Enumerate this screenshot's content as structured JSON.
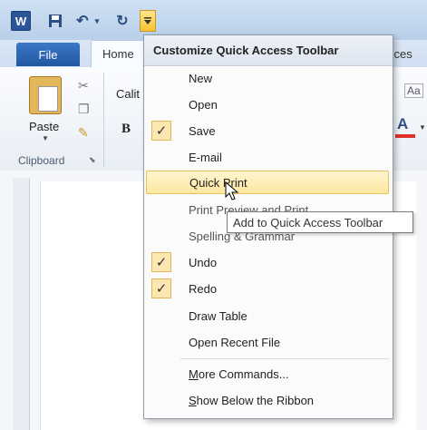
{
  "app": {
    "logo_letter": "W",
    "tabs": {
      "file": "File",
      "home": "Home",
      "references_partial": "ences"
    },
    "ribbon": {
      "paste": "Paste",
      "clipboard_group": "Clipboard",
      "font_name": "Calit",
      "bold": "B",
      "font_color": "A"
    }
  },
  "menu": {
    "title": "Customize Quick Access Toolbar",
    "items": [
      {
        "label": "New",
        "checked": false
      },
      {
        "label": "Open",
        "checked": false
      },
      {
        "label": "Save",
        "checked": true
      },
      {
        "label": "E-mail",
        "checked": false
      },
      {
        "label": "Quick Print",
        "checked": false,
        "hovered": true
      },
      {
        "label": "Print Preview and Print",
        "checked": false
      },
      {
        "label": "Spelling & Grammar",
        "checked": false
      },
      {
        "label": "Undo",
        "checked": true
      },
      {
        "label": "Redo",
        "checked": true
      },
      {
        "label": "Draw Table",
        "checked": false
      },
      {
        "label": "Open Recent File",
        "checked": false
      }
    ],
    "more_commands": "More Commands...",
    "show_below": "Show Below the Ribbon",
    "check_glyph": "✓"
  },
  "tooltip": {
    "text": "Add to Quick Access Toolbar"
  },
  "colors": {
    "accent": "#2b579a",
    "hover": "#fde7a0",
    "check_bg": "#fde7b0"
  }
}
